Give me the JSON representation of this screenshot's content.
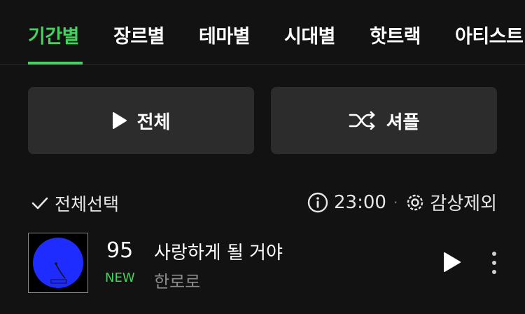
{
  "tabs": [
    {
      "label": "기간별",
      "active": true
    },
    {
      "label": "장르별",
      "active": false
    },
    {
      "label": "테마별",
      "active": false
    },
    {
      "label": "시대별",
      "active": false
    },
    {
      "label": "핫트랙",
      "active": false
    },
    {
      "label": "아티스트",
      "active": false
    }
  ],
  "actions": {
    "play_all_label": "전체",
    "shuffle_label": "셔플"
  },
  "controls": {
    "select_all_label": "전체선택",
    "time": "23:00",
    "separator": "·",
    "exclude_label": "감상제외"
  },
  "songs": [
    {
      "rank": "95",
      "badge": "NEW",
      "title": "사랑하게 될 거야",
      "artist": "한로로"
    }
  ],
  "colors": {
    "accent": "#46d160",
    "background": "#121212",
    "button_bg": "#2c2c2c",
    "album_art_blue": "#1f2cff"
  }
}
